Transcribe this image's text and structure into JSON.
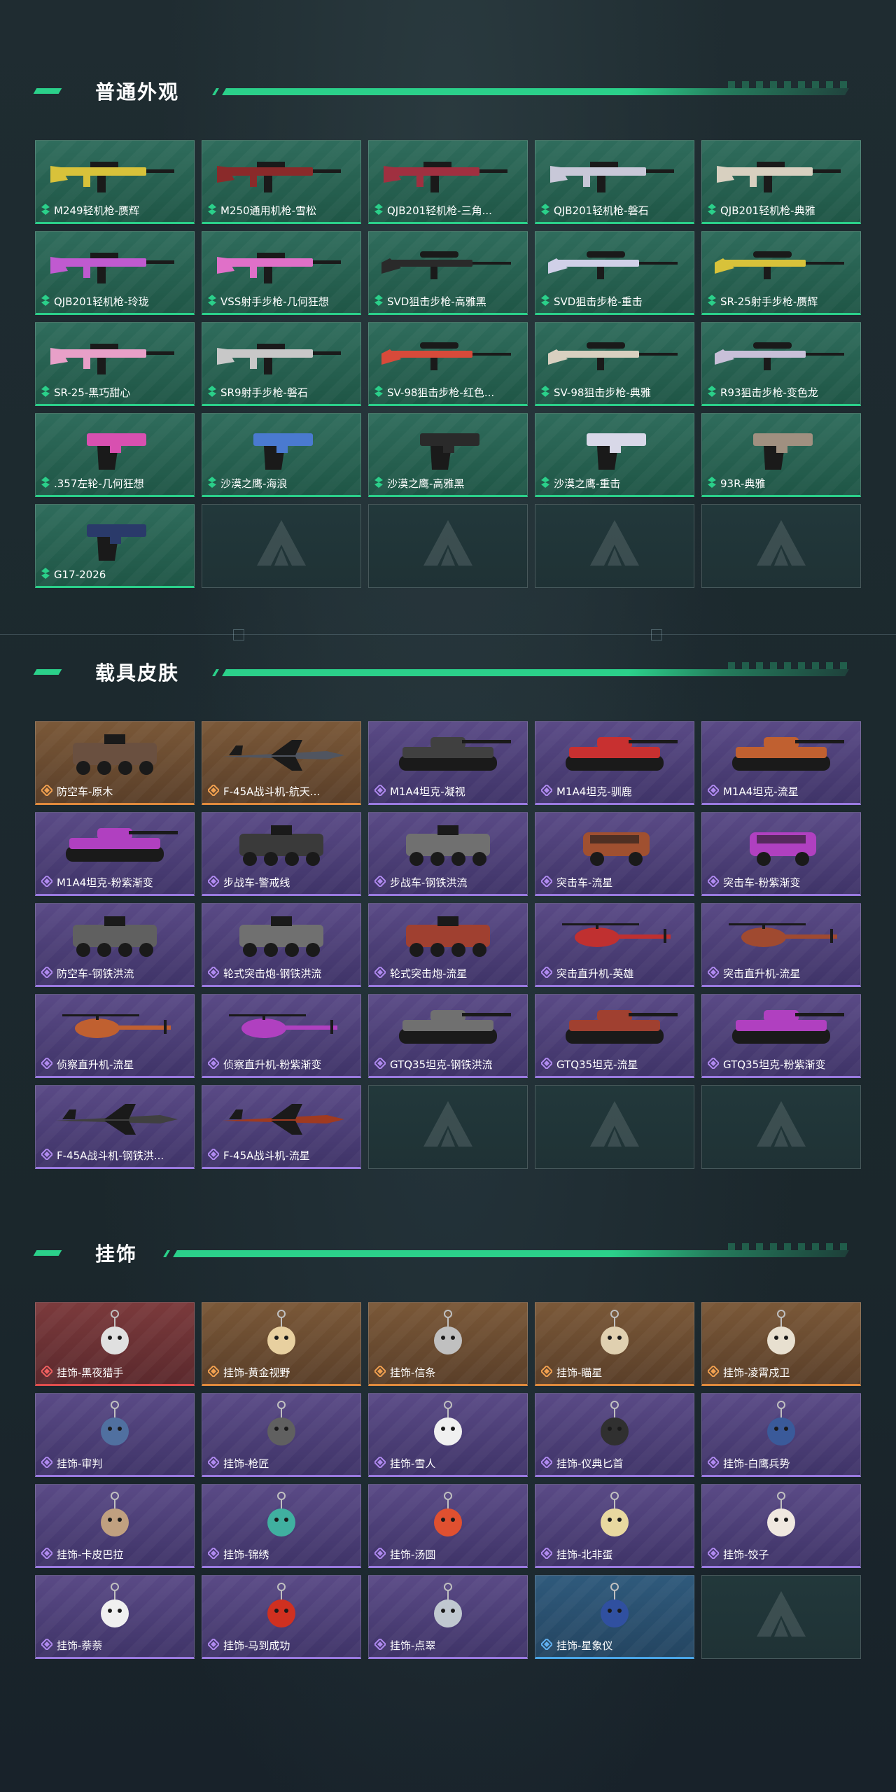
{
  "sections": [
    {
      "title": "普通外观",
      "items": [
        {
          "label": "M249轻机枪-赝辉",
          "icon": "rifle-icon",
          "color": "#d8c23a",
          "quality": "green"
        },
        {
          "label": "M250通用机枪-雪松",
          "icon": "machine-gun-icon",
          "color": "#8a2a2a",
          "quality": "green"
        },
        {
          "label": "QJB201轻机枪-三角...",
          "icon": "rifle-icon",
          "color": "#a03040",
          "quality": "green"
        },
        {
          "label": "QJB201轻机枪-磐石",
          "icon": "rifle-icon",
          "color": "#c8c8d8",
          "quality": "green"
        },
        {
          "label": "QJB201轻机枪-典雅",
          "icon": "rifle-icon",
          "color": "#d8d0c0",
          "quality": "green"
        },
        {
          "label": "QJB201轻机枪-玲珑",
          "icon": "rifle-icon",
          "color": "#c05ad0",
          "quality": "green"
        },
        {
          "label": "VSS射手步枪-几何狂想",
          "icon": "rifle-icon",
          "color": "#e070c8",
          "quality": "green"
        },
        {
          "label": "SVD狙击步枪-高雅黑",
          "icon": "sniper-icon",
          "color": "#2a2a2a",
          "quality": "green"
        },
        {
          "label": "SVD狙击步枪-重击",
          "icon": "sniper-icon",
          "color": "#d0d0e8",
          "quality": "green"
        },
        {
          "label": "SR-25射手步枪-赝辉",
          "icon": "sniper-icon",
          "color": "#d8c23a",
          "quality": "green"
        },
        {
          "label": "SR-25-黑巧甜心",
          "icon": "rifle-icon",
          "color": "#e8a0c8",
          "quality": "green"
        },
        {
          "label": "SR9射手步枪-磐石",
          "icon": "rifle-icon",
          "color": "#c8c8c8",
          "quality": "green"
        },
        {
          "label": "SV-98狙击步枪-红色...",
          "icon": "sniper-icon",
          "color": "#d84a3a",
          "quality": "green"
        },
        {
          "label": "SV-98狙击步枪-典雅",
          "icon": "sniper-icon",
          "color": "#d8d0c0",
          "quality": "green"
        },
        {
          "label": "R93狙击步枪-变色龙",
          "icon": "sniper-icon",
          "color": "#c8c0d8",
          "quality": "green"
        },
        {
          "label": ".357左轮-几何狂想",
          "icon": "revolver-icon",
          "color": "#d850b0",
          "quality": "green"
        },
        {
          "label": "沙漠之鹰-海浪",
          "icon": "pistol-icon",
          "color": "#4a7ad0",
          "quality": "green"
        },
        {
          "label": "沙漠之鹰-高雅黑",
          "icon": "pistol-icon",
          "color": "#2a2a2a",
          "quality": "green"
        },
        {
          "label": "沙漠之鹰-重击",
          "icon": "pistol-icon",
          "color": "#d8d8e8",
          "quality": "green"
        },
        {
          "label": "93R-典雅",
          "icon": "pistol-icon",
          "color": "#a09080",
          "quality": "green"
        },
        {
          "label": "G17-2026",
          "icon": "pistol-icon",
          "color": "#2a3a6a",
          "quality": "green"
        }
      ]
    },
    {
      "title": "载具皮肤",
      "items": [
        {
          "label": "防空车-原木",
          "icon": "armored-vehicle-icon",
          "color": "#6a5040",
          "quality": "orange"
        },
        {
          "label": "F-45A战斗机-航天...",
          "icon": "fighter-jet-icon",
          "color": "#505560",
          "quality": "orange"
        },
        {
          "label": "M1A4坦克-凝视",
          "icon": "tank-icon",
          "color": "#404040",
          "quality": "purple"
        },
        {
          "label": "M1A4坦克-驯鹿",
          "icon": "tank-icon",
          "color": "#c83030",
          "quality": "purple"
        },
        {
          "label": "M1A4坦克-流星",
          "icon": "tank-icon",
          "color": "#c06030",
          "quality": "purple"
        },
        {
          "label": "M1A4坦克-粉紫渐变",
          "icon": "tank-icon",
          "color": "#b040c0",
          "quality": "purple"
        },
        {
          "label": "步战车-警戒线",
          "icon": "armored-vehicle-icon",
          "color": "#3a3a3a",
          "quality": "purple"
        },
        {
          "label": "步战车-钢铁洪流",
          "icon": "armored-vehicle-icon",
          "color": "#707070",
          "quality": "purple"
        },
        {
          "label": "突击车-流星",
          "icon": "assault-car-icon",
          "color": "#a05030",
          "quality": "purple"
        },
        {
          "label": "突击车-粉紫渐变",
          "icon": "assault-car-icon",
          "color": "#b040c0",
          "quality": "purple"
        },
        {
          "label": "防空车-钢铁洪流",
          "icon": "armored-vehicle-icon",
          "color": "#606060",
          "quality": "purple"
        },
        {
          "label": "轮式突击炮-钢铁洪流",
          "icon": "armored-vehicle-icon",
          "color": "#707070",
          "quality": "purple"
        },
        {
          "label": "轮式突击炮-流星",
          "icon": "armored-vehicle-icon",
          "color": "#a04030",
          "quality": "purple"
        },
        {
          "label": "突击直升机-英雄",
          "icon": "helicopter-icon",
          "color": "#c03030",
          "quality": "purple"
        },
        {
          "label": "突击直升机-流星",
          "icon": "helicopter-icon",
          "color": "#a04a30",
          "quality": "purple"
        },
        {
          "label": "侦察直升机-流星",
          "icon": "helicopter-icon",
          "color": "#c06030",
          "quality": "purple"
        },
        {
          "label": "侦察直升机-粉紫渐变",
          "icon": "helicopter-icon",
          "color": "#b040c0",
          "quality": "purple"
        },
        {
          "label": "GTQ35坦克-钢铁洪流",
          "icon": "tank-icon",
          "color": "#707070",
          "quality": "purple"
        },
        {
          "label": "GTQ35坦克-流星",
          "icon": "tank-icon",
          "color": "#a04030",
          "quality": "purple"
        },
        {
          "label": "GTQ35坦克-粉紫渐变",
          "icon": "tank-icon",
          "color": "#b040c0",
          "quality": "purple"
        },
        {
          "label": "F-45A战斗机-钢铁洪...",
          "icon": "fighter-jet-icon",
          "color": "#404040",
          "quality": "purple"
        },
        {
          "label": "F-45A战斗机-流星",
          "icon": "fighter-jet-icon",
          "color": "#a03a20",
          "quality": "purple"
        }
      ]
    },
    {
      "title": "挂饰",
      "items": [
        {
          "label": "挂饰-黑夜猎手",
          "icon": "charm-icon",
          "color": "#e0e0e0",
          "quality": "red"
        },
        {
          "label": "挂饰-黄金视野",
          "icon": "charm-icon",
          "color": "#e8d0a0",
          "quality": "orange"
        },
        {
          "label": "挂饰-信条",
          "icon": "charm-icon",
          "color": "#c0c0c0",
          "quality": "orange"
        },
        {
          "label": "挂饰-瞄星",
          "icon": "charm-icon",
          "color": "#e0d0b0",
          "quality": "orange"
        },
        {
          "label": "挂饰-凌霄戍卫",
          "icon": "charm-icon",
          "color": "#e8e0d0",
          "quality": "orange"
        },
        {
          "label": "挂饰-审判",
          "icon": "charm-icon",
          "color": "#5070a0",
          "quality": "purple"
        },
        {
          "label": "挂饰-枪匠",
          "icon": "charm-icon",
          "color": "#606060",
          "quality": "purple"
        },
        {
          "label": "挂饰-雪人",
          "icon": "charm-icon",
          "color": "#f0f0f0",
          "quality": "purple"
        },
        {
          "label": "挂饰-仪典匕首",
          "icon": "charm-icon",
          "color": "#303030",
          "quality": "purple"
        },
        {
          "label": "挂饰-白鹰兵势",
          "icon": "charm-icon",
          "color": "#3a5a9a",
          "quality": "purple"
        },
        {
          "label": "挂饰-卡皮巴拉",
          "icon": "charm-icon",
          "color": "#c0a080",
          "quality": "purple"
        },
        {
          "label": "挂饰-锦绣",
          "icon": "charm-icon",
          "color": "#40b0a0",
          "quality": "purple"
        },
        {
          "label": "挂饰-汤圆",
          "icon": "charm-icon",
          "color": "#e05030",
          "quality": "purple"
        },
        {
          "label": "挂饰-北非蛋",
          "icon": "charm-icon",
          "color": "#e8d8a0",
          "quality": "purple"
        },
        {
          "label": "挂饰-饺子",
          "icon": "charm-icon",
          "color": "#f0e8e0",
          "quality": "purple"
        },
        {
          "label": "挂饰-萘萘",
          "icon": "charm-icon",
          "color": "#f0f0f0",
          "quality": "purple"
        },
        {
          "label": "挂饰-马到成功",
          "icon": "charm-icon",
          "color": "#d03020",
          "quality": "purple"
        },
        {
          "label": "挂饰-点翠",
          "icon": "charm-icon",
          "color": "#c0c8d0",
          "quality": "purple"
        },
        {
          "label": "挂饰-星象仪",
          "icon": "charm-icon",
          "color": "#3050a0",
          "quality": "blue"
        }
      ]
    }
  ],
  "colors": {
    "accent": "#2bd08a",
    "background": "#1c2a2f"
  }
}
